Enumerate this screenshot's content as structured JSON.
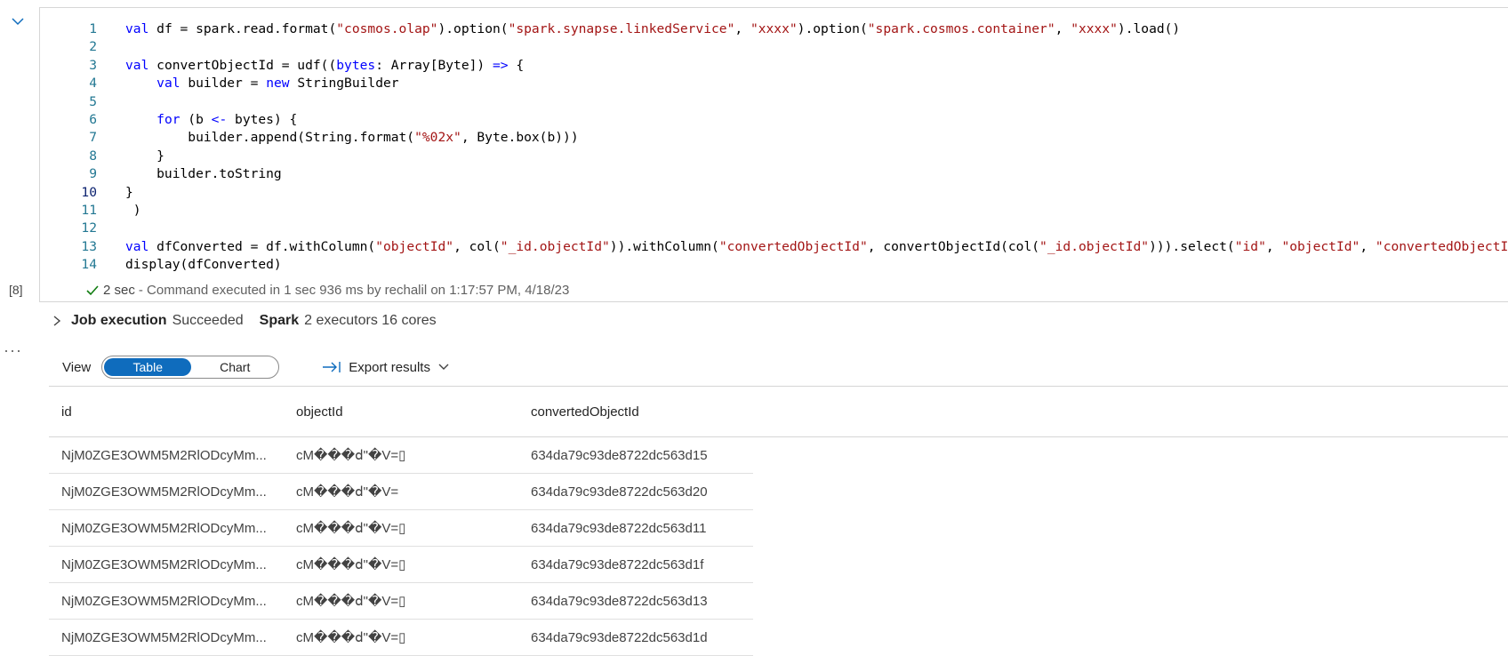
{
  "cell": {
    "lines": [
      {
        "n": "1",
        "segs": [
          [
            "kw",
            "val"
          ],
          [
            "",
            "df"
          ],
          [
            "",
            " = spark.read.format("
          ],
          [
            "str",
            "\"cosmos.olap\""
          ],
          [
            "",
            ").option("
          ],
          [
            "str",
            "\"spark.synapse.linkedService\""
          ],
          [
            "",
            ", "
          ],
          [
            "str",
            "\"xxxx\""
          ],
          [
            "",
            ").option("
          ],
          [
            "str",
            "\"spark.cosmos.container\""
          ],
          [
            "",
            ", "
          ],
          [
            "str",
            "\"xxxx\""
          ],
          [
            "",
            ").load()"
          ]
        ]
      },
      {
        "n": "2",
        "segs": []
      },
      {
        "n": "3",
        "segs": [
          [
            "kw",
            "val"
          ],
          [
            "",
            "convertObjectId"
          ],
          [
            "",
            " = udf(("
          ],
          [
            "kw",
            "bytes"
          ],
          [
            "",
            ": Array[Byte]) "
          ],
          [
            "kw",
            "=>"
          ],
          [
            "",
            " {"
          ]
        ]
      },
      {
        "n": "4",
        "segs": [
          [
            "",
            "    "
          ],
          [
            "kw",
            "val"
          ],
          [
            "",
            "builder"
          ],
          [
            "",
            " = "
          ],
          [
            "kw",
            "new"
          ],
          [
            "",
            " StringBuilder"
          ]
        ]
      },
      {
        "n": "5",
        "segs": []
      },
      {
        "n": "6",
        "segs": [
          [
            "",
            "    "
          ],
          [
            "kw",
            "for"
          ],
          [
            "",
            " (b "
          ],
          [
            "kw",
            "<-"
          ],
          [
            "",
            " bytes) {"
          ]
        ]
      },
      {
        "n": "7",
        "segs": [
          [
            "",
            "        builder.append(String.format("
          ],
          [
            "str",
            "\"%02x\""
          ],
          [
            "",
            ", Byte.box(b)))"
          ]
        ]
      },
      {
        "n": "8",
        "segs": [
          [
            "",
            "    }"
          ]
        ]
      },
      {
        "n": "9",
        "segs": [
          [
            "",
            "    builder.toString"
          ]
        ]
      },
      {
        "n": "10",
        "segs": [
          [
            "",
            "}"
          ]
        ],
        "active": true
      },
      {
        "n": "11",
        "segs": [
          [
            "",
            " )"
          ]
        ]
      },
      {
        "n": "12",
        "segs": []
      },
      {
        "n": "13",
        "segs": [
          [
            "kw",
            "val"
          ],
          [
            "",
            "dfConverted"
          ],
          [
            "",
            " = df.withColumn("
          ],
          [
            "str",
            "\"objectId\""
          ],
          [
            "",
            ", col("
          ],
          [
            "str",
            "\"_id.objectId\""
          ],
          [
            "",
            ")).withColumn("
          ],
          [
            "str",
            "\"convertedObjectId\""
          ],
          [
            "",
            ", convertObjectId(col("
          ],
          [
            "str",
            "\"_id.objectId\""
          ],
          [
            "",
            ")))"
          ],
          [
            "",
            ".select("
          ],
          [
            "str",
            "\"id\""
          ],
          [
            "",
            ", "
          ],
          [
            "str",
            "\"objectId\""
          ],
          [
            "",
            ", "
          ],
          [
            "str",
            "\"convertedObjectId\""
          ],
          [
            "",
            ")"
          ]
        ]
      },
      {
        "n": "14",
        "segs": [
          [
            "",
            "display(dfConverted)"
          ]
        ]
      }
    ]
  },
  "exec_count": "[8]",
  "status": {
    "duration": "2 sec",
    "message": "- Command executed in 1 sec 936 ms by rechalil on 1:17:57 PM, 4/18/23"
  },
  "job": {
    "label": "Job execution",
    "state": "Succeeded",
    "spark_label": "Spark",
    "spark_info": "2 executors 16 cores"
  },
  "view": {
    "label": "View",
    "table": "Table",
    "chart": "Chart",
    "export": "Export results"
  },
  "table": {
    "headers": [
      "id",
      "objectId",
      "convertedObjectId"
    ],
    "rows": [
      [
        "NjM0ZGE3OWM5M2RlODcyMm...",
        "cM���ⅾ\"�V=▯",
        "634da79c93de8722dc563d15"
      ],
      [
        "NjM0ZGE3OWM5M2RlODcyMm...",
        "cM���ⅾ\"�V=",
        "634da79c93de8722dc563d20"
      ],
      [
        "NjM0ZGE3OWM5M2RlODcyMm...",
        "cM���ⅾ\"�V=▯",
        "634da79c93de8722dc563d11"
      ],
      [
        "NjM0ZGE3OWM5M2RlODcyMm...",
        "cM���ⅾ\"�V=▯",
        "634da79c93de8722dc563d1f"
      ],
      [
        "NjM0ZGE3OWM5M2RlODcyMm...",
        "cM���ⅾ\"�V=▯",
        "634da79c93de8722dc563d13"
      ],
      [
        "NjM0ZGE3OWM5M2RlODcyMm...",
        "cM���ⅾ\"�V=▯",
        "634da79c93de8722dc563d1d"
      ]
    ]
  }
}
